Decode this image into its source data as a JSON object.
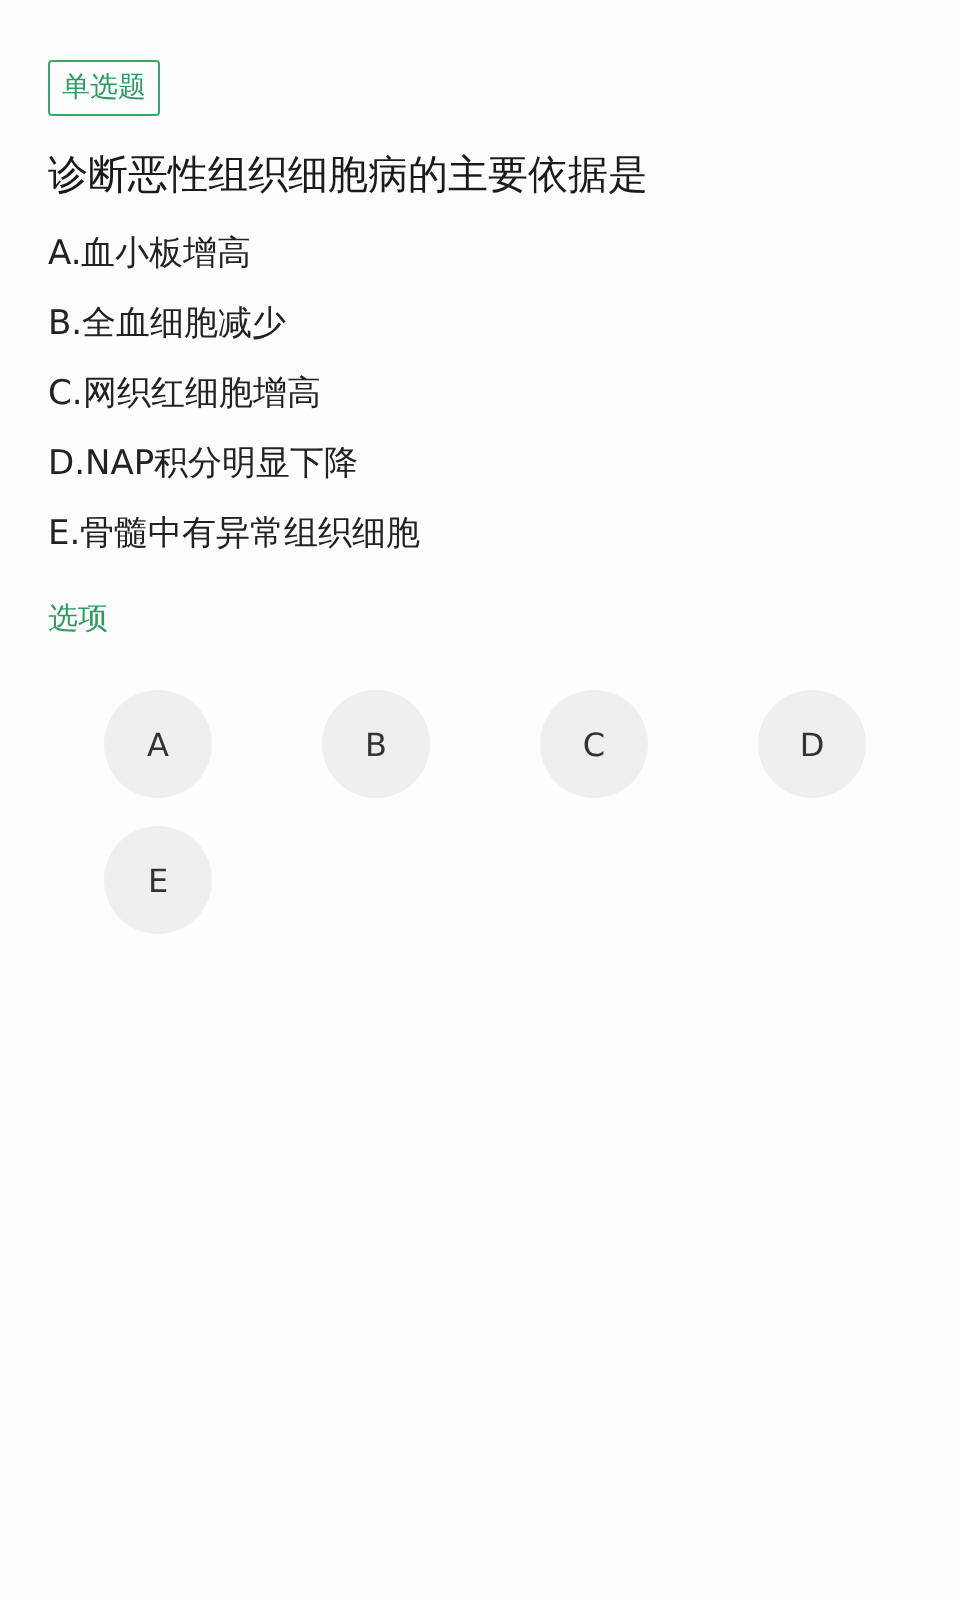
{
  "question_type": "单选题",
  "question": "诊断恶性组织细胞病的主要依据是",
  "options": [
    "A.血小板增高",
    "B.全血细胞减少",
    "C.网织红细胞增高",
    "D.NAP积分明显下降",
    "E.骨髓中有异常组织细胞"
  ],
  "choices_label": "选项",
  "choices": [
    "A",
    "B",
    "C",
    "D",
    "E"
  ]
}
